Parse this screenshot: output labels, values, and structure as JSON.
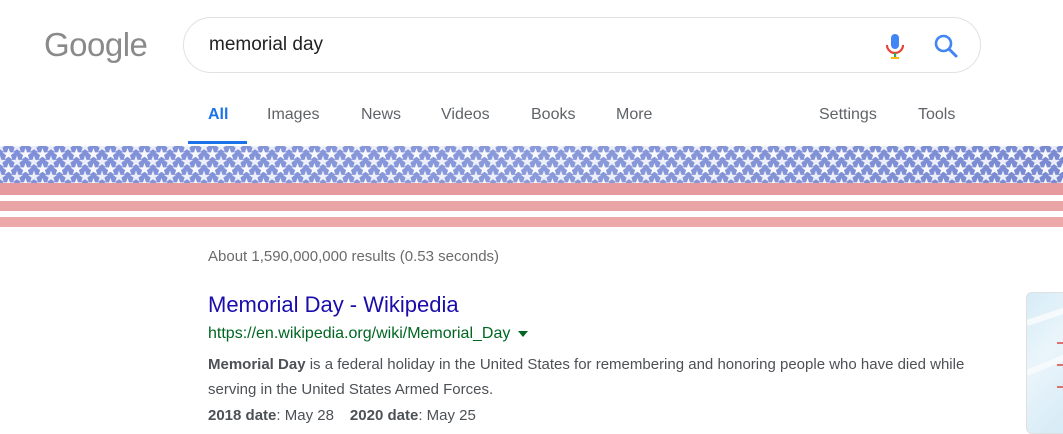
{
  "logo": {
    "text": "Google"
  },
  "search": {
    "query": "memorial day"
  },
  "tabs": [
    {
      "label": "All",
      "active": true
    },
    {
      "label": "Images"
    },
    {
      "label": "News"
    },
    {
      "label": "Videos"
    },
    {
      "label": "Books"
    },
    {
      "label": "More"
    }
  ],
  "tools": {
    "settings_label": "Settings",
    "tools_label": "Tools"
  },
  "results": {
    "stats": "About 1,590,000,000 results (0.53 seconds)",
    "first": {
      "title": "Memorial Day - Wikipedia",
      "url": "https://en.wikipedia.org/wiki/Memorial_Day",
      "snippet_bold": "Memorial Day",
      "snippet_rest": " is a federal holiday in the United States for remembering and honoring people who have died while serving in the United States Armed Forces.",
      "date1_label": "2018 date",
      "date1_value": ": May 28",
      "date2_label": "2020 date",
      "date2_value": ": May 25"
    }
  },
  "colors": {
    "link": "#1a0dab",
    "url_green": "#006621",
    "accent_blue": "#1a73e8",
    "flag_blue": "#7d8fd6",
    "flag_red": "#e99a9c"
  },
  "icons": {
    "mic": "microphone-icon",
    "search": "search-icon",
    "dropdown": "caret-down-icon"
  }
}
